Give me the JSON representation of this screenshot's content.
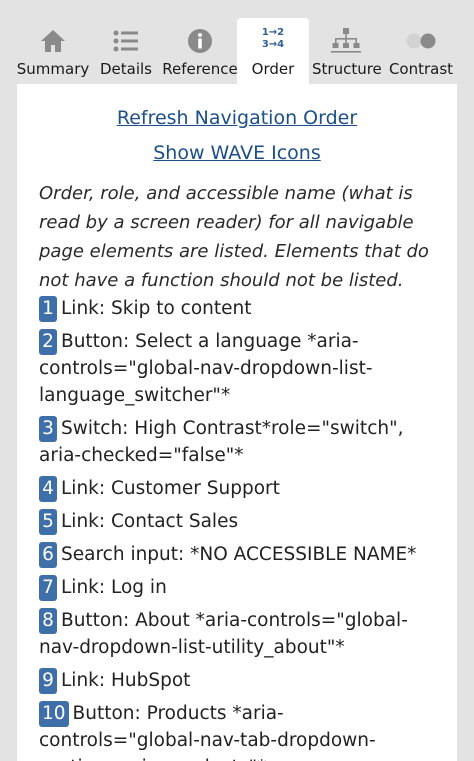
{
  "tabs": [
    {
      "label": "Summary",
      "icon": "home-icon"
    },
    {
      "label": "Details",
      "icon": "list-icon"
    },
    {
      "label": "Reference",
      "icon": "info-icon"
    },
    {
      "label": "Order",
      "icon": "order-icon",
      "active": true,
      "icon_text_top": "1→2",
      "icon_text_bottom": "3→4"
    },
    {
      "label": "Structure",
      "icon": "sitemap-icon"
    },
    {
      "label": "Contrast",
      "icon": "toggle-icon"
    }
  ],
  "links": {
    "refresh": "Refresh Navigation Order",
    "show_icons": "Show WAVE Icons"
  },
  "description": "Order, role, and accessible name (what is read by a screen reader) for all navigable page elements are listed. Elements that do not have a function should not be listed.",
  "items": [
    {
      "num": "1",
      "text": "Link: Skip to content"
    },
    {
      "num": "2",
      "text": "Button: Select a language *aria-controls=\"global-nav-dropdown-list-language_switcher\"*"
    },
    {
      "num": "3",
      "text": "Switch: High Contrast*role=\"switch\", aria-checked=\"false\"*"
    },
    {
      "num": "4",
      "text": "Link: Customer Support"
    },
    {
      "num": "5",
      "text": "Link: Contact Sales"
    },
    {
      "num": "6",
      "text": "Search input: *NO ACCESSIBLE NAME*"
    },
    {
      "num": "7",
      "text": "Link: Log in"
    },
    {
      "num": "8",
      "text": "Button: About *aria-controls=\"global-nav-dropdown-list-utility_about\"*"
    },
    {
      "num": "9",
      "text": "Link: HubSpot"
    },
    {
      "num": "10",
      "text": "Button: Products *aria-controls=\"global-nav-tab-dropdown-section-main_products\"*"
    }
  ],
  "colors": {
    "accent": "#3e6fa9",
    "link": "#1c4f8a",
    "icon_gray": "#8a8a8a",
    "background": "#e3e3e3"
  }
}
